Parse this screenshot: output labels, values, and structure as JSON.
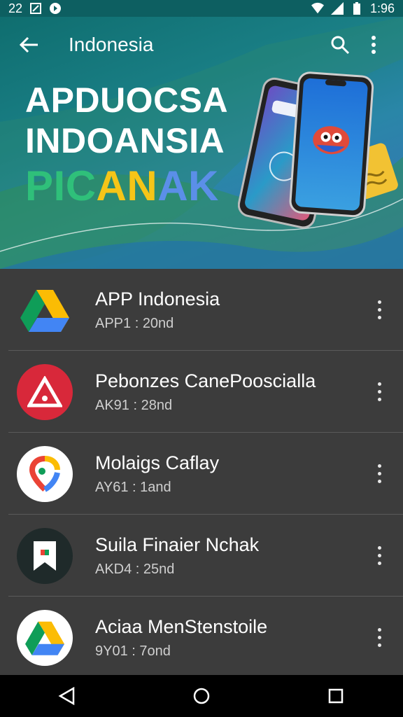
{
  "status_bar": {
    "time_left": "22",
    "time_right": "1:96"
  },
  "app_bar": {
    "title": "Indonesia"
  },
  "hero": {
    "line1": "APDUOCSA",
    "line2": "INDOANSIA",
    "line3_parts": [
      "PIC",
      "AN",
      "AK"
    ]
  },
  "apps": [
    {
      "title": "APP Indonesia",
      "subtitle": "APP1 : 20nd",
      "icon": "drive-icon"
    },
    {
      "title": "Pebonzes CanePooscialla",
      "subtitle": "AK91 : 28nd",
      "icon": "warning-triangle-icon"
    },
    {
      "title": "Molaigs Caflay",
      "subtitle": "AY61 : 1and",
      "icon": "maps-pin-icon"
    },
    {
      "title": "Suila Finaier Nchak",
      "subtitle": "AKD4 : 25nd",
      "icon": "bookmark-icon"
    },
    {
      "title": "Aciaa MenStenstoile",
      "subtitle": "9Y01 : 7ond",
      "icon": "drive-circle-icon"
    }
  ],
  "colors": {
    "accent": "#0d5f61",
    "list_bg": "#3c3c3c"
  }
}
